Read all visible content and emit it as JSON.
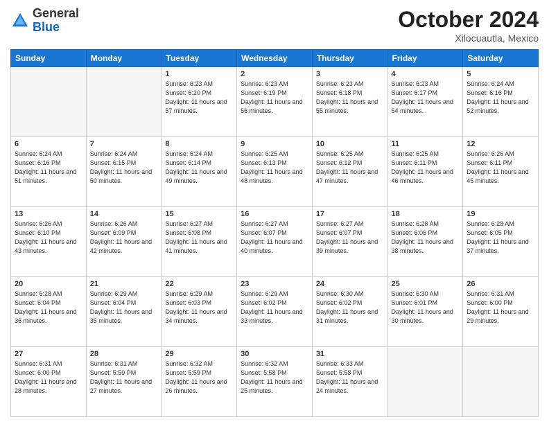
{
  "logo": {
    "general": "General",
    "blue": "Blue"
  },
  "header": {
    "month_year": "October 2024",
    "location": "Xilocuautla, Mexico"
  },
  "days_of_week": [
    "Sunday",
    "Monday",
    "Tuesday",
    "Wednesday",
    "Thursday",
    "Friday",
    "Saturday"
  ],
  "weeks": [
    [
      {
        "day": "",
        "empty": true
      },
      {
        "day": "",
        "empty": true
      },
      {
        "day": "1",
        "sunrise": "6:23 AM",
        "sunset": "6:20 PM",
        "daylight": "11 hours and 57 minutes."
      },
      {
        "day": "2",
        "sunrise": "6:23 AM",
        "sunset": "6:19 PM",
        "daylight": "11 hours and 56 minutes."
      },
      {
        "day": "3",
        "sunrise": "6:23 AM",
        "sunset": "6:18 PM",
        "daylight": "11 hours and 55 minutes."
      },
      {
        "day": "4",
        "sunrise": "6:23 AM",
        "sunset": "6:17 PM",
        "daylight": "11 hours and 54 minutes."
      },
      {
        "day": "5",
        "sunrise": "6:24 AM",
        "sunset": "6:16 PM",
        "daylight": "11 hours and 52 minutes."
      }
    ],
    [
      {
        "day": "6",
        "sunrise": "6:24 AM",
        "sunset": "6:16 PM",
        "daylight": "11 hours and 51 minutes."
      },
      {
        "day": "7",
        "sunrise": "6:24 AM",
        "sunset": "6:15 PM",
        "daylight": "11 hours and 50 minutes."
      },
      {
        "day": "8",
        "sunrise": "6:24 AM",
        "sunset": "6:14 PM",
        "daylight": "11 hours and 49 minutes."
      },
      {
        "day": "9",
        "sunrise": "6:25 AM",
        "sunset": "6:13 PM",
        "daylight": "11 hours and 48 minutes."
      },
      {
        "day": "10",
        "sunrise": "6:25 AM",
        "sunset": "6:12 PM",
        "daylight": "11 hours and 47 minutes."
      },
      {
        "day": "11",
        "sunrise": "6:25 AM",
        "sunset": "6:11 PM",
        "daylight": "11 hours and 46 minutes."
      },
      {
        "day": "12",
        "sunrise": "6:26 AM",
        "sunset": "6:11 PM",
        "daylight": "11 hours and 45 minutes."
      }
    ],
    [
      {
        "day": "13",
        "sunrise": "6:26 AM",
        "sunset": "6:10 PM",
        "daylight": "11 hours and 43 minutes."
      },
      {
        "day": "14",
        "sunrise": "6:26 AM",
        "sunset": "6:09 PM",
        "daylight": "11 hours and 42 minutes."
      },
      {
        "day": "15",
        "sunrise": "6:27 AM",
        "sunset": "6:08 PM",
        "daylight": "11 hours and 41 minutes."
      },
      {
        "day": "16",
        "sunrise": "6:27 AM",
        "sunset": "6:07 PM",
        "daylight": "11 hours and 40 minutes."
      },
      {
        "day": "17",
        "sunrise": "6:27 AM",
        "sunset": "6:07 PM",
        "daylight": "11 hours and 39 minutes."
      },
      {
        "day": "18",
        "sunrise": "6:28 AM",
        "sunset": "6:06 PM",
        "daylight": "11 hours and 38 minutes."
      },
      {
        "day": "19",
        "sunrise": "6:28 AM",
        "sunset": "6:05 PM",
        "daylight": "11 hours and 37 minutes."
      }
    ],
    [
      {
        "day": "20",
        "sunrise": "6:28 AM",
        "sunset": "6:04 PM",
        "daylight": "11 hours and 36 minutes."
      },
      {
        "day": "21",
        "sunrise": "6:29 AM",
        "sunset": "6:04 PM",
        "daylight": "11 hours and 35 minutes."
      },
      {
        "day": "22",
        "sunrise": "6:29 AM",
        "sunset": "6:03 PM",
        "daylight": "11 hours and 34 minutes."
      },
      {
        "day": "23",
        "sunrise": "6:29 AM",
        "sunset": "6:02 PM",
        "daylight": "11 hours and 33 minutes."
      },
      {
        "day": "24",
        "sunrise": "6:30 AM",
        "sunset": "6:02 PM",
        "daylight": "11 hours and 31 minutes."
      },
      {
        "day": "25",
        "sunrise": "6:30 AM",
        "sunset": "6:01 PM",
        "daylight": "11 hours and 30 minutes."
      },
      {
        "day": "26",
        "sunrise": "6:31 AM",
        "sunset": "6:00 PM",
        "daylight": "11 hours and 29 minutes."
      }
    ],
    [
      {
        "day": "27",
        "sunrise": "6:31 AM",
        "sunset": "6:00 PM",
        "daylight": "11 hours and 28 minutes."
      },
      {
        "day": "28",
        "sunrise": "6:31 AM",
        "sunset": "5:59 PM",
        "daylight": "11 hours and 27 minutes."
      },
      {
        "day": "29",
        "sunrise": "6:32 AM",
        "sunset": "5:59 PM",
        "daylight": "11 hours and 26 minutes."
      },
      {
        "day": "30",
        "sunrise": "6:32 AM",
        "sunset": "5:58 PM",
        "daylight": "11 hours and 25 minutes."
      },
      {
        "day": "31",
        "sunrise": "6:33 AM",
        "sunset": "5:58 PM",
        "daylight": "11 hours and 24 minutes."
      },
      {
        "day": "",
        "empty": true
      },
      {
        "day": "",
        "empty": true
      }
    ]
  ]
}
